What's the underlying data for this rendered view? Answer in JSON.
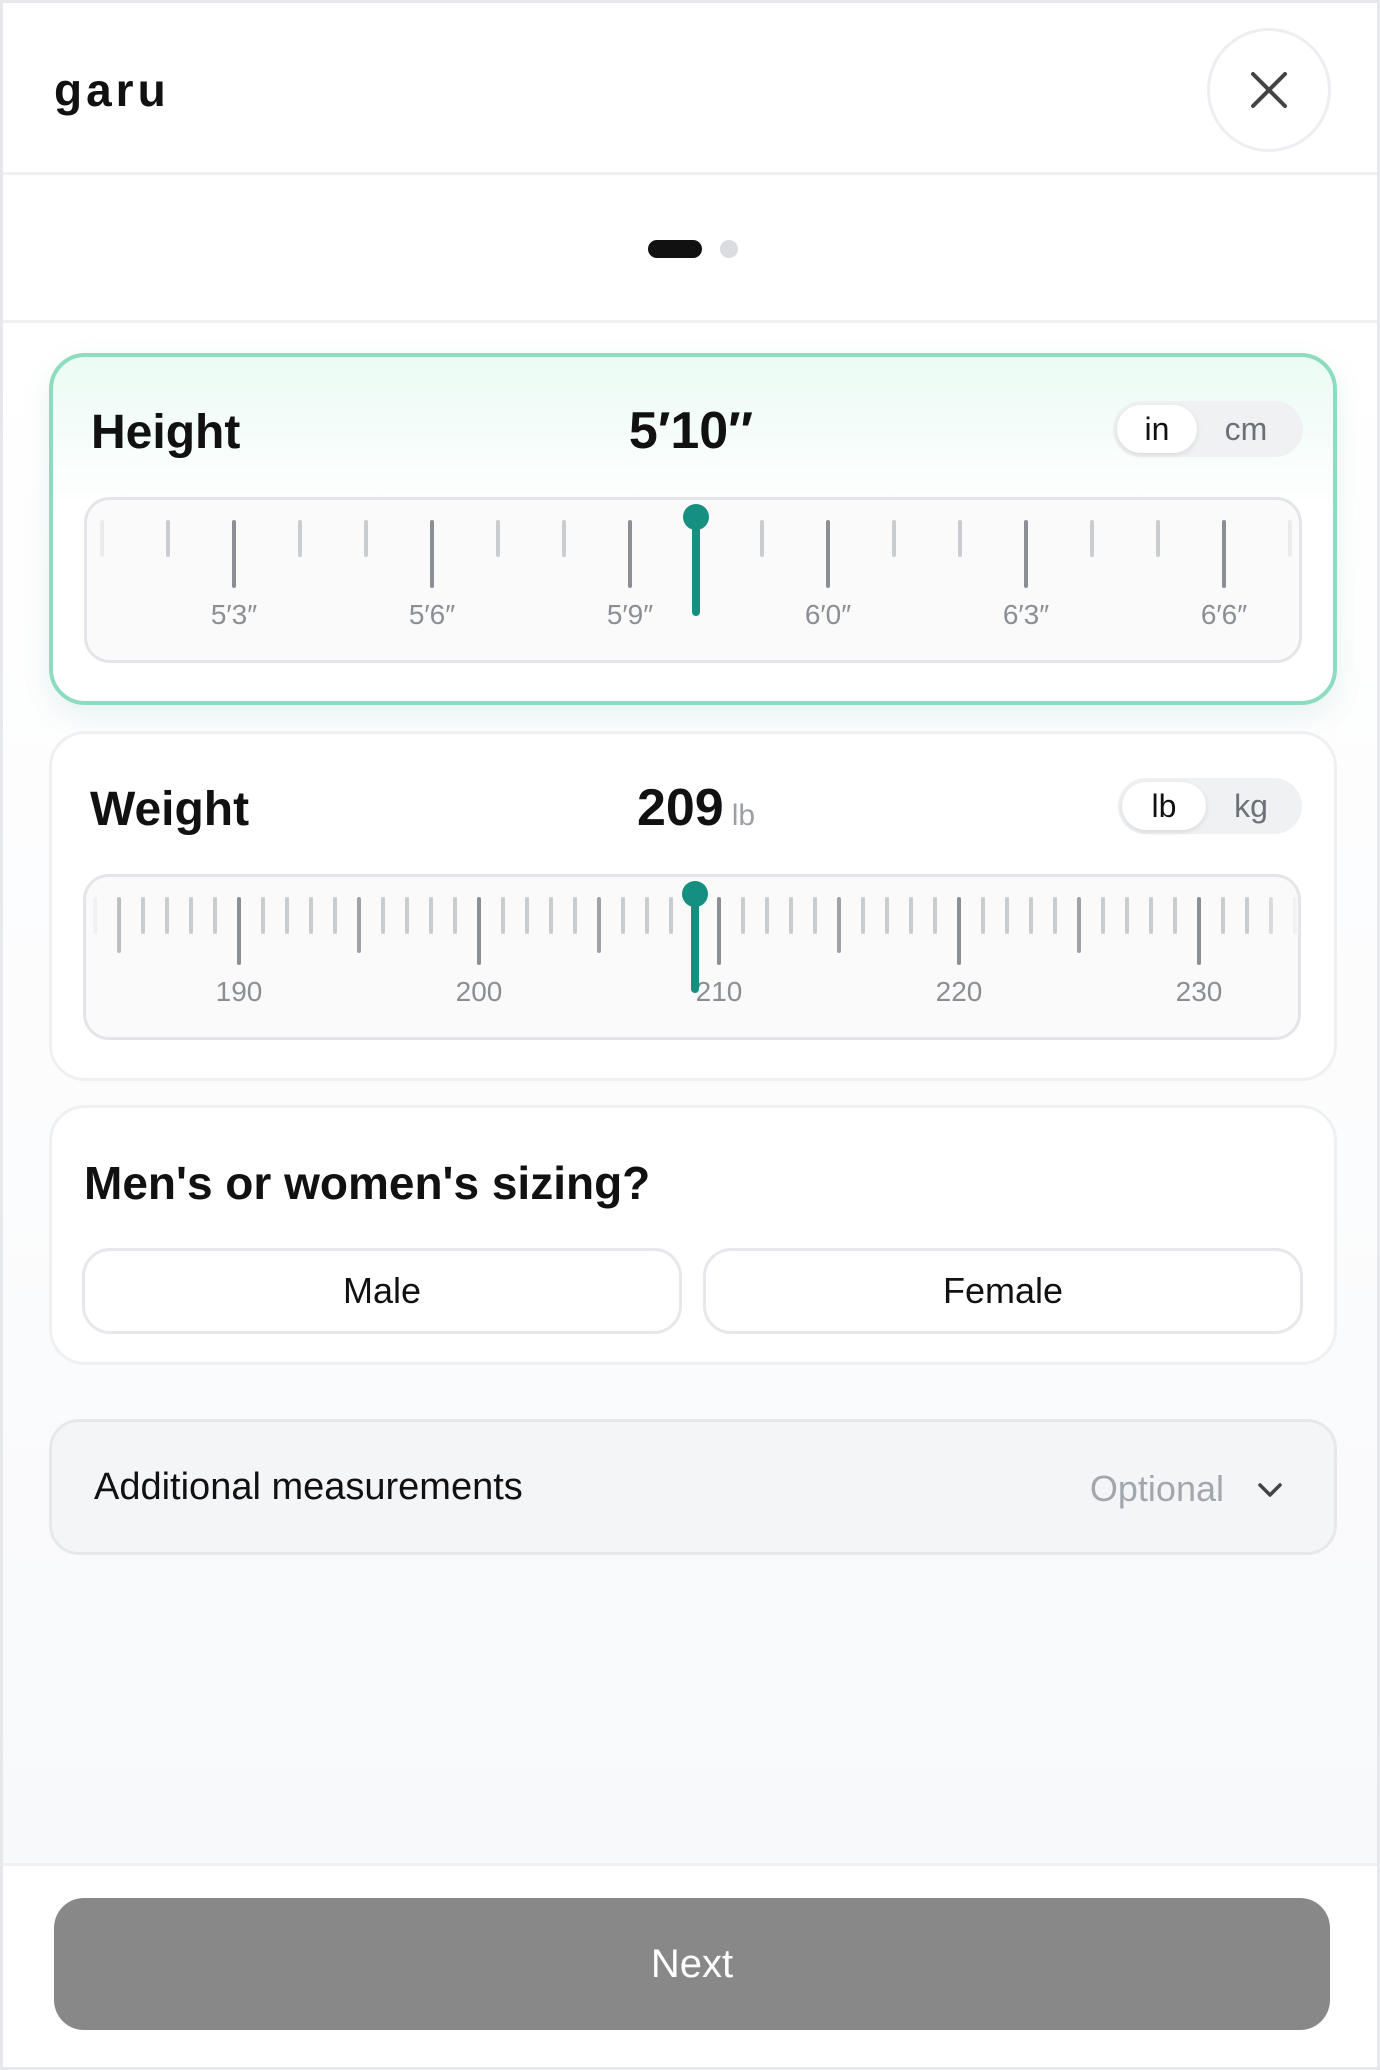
{
  "header": {
    "logo": "garu",
    "close_icon": "close-icon"
  },
  "progress": {
    "current_step": 1,
    "total_steps": 2
  },
  "height": {
    "title": "Height",
    "value": "5′10″",
    "units": [
      "in",
      "cm"
    ],
    "selected_unit": "in",
    "ruler": {
      "tick_labels": [
        "5′3″",
        "5′6″",
        "5′9″",
        "6′0″",
        "6′3″",
        "6′6″"
      ],
      "selected_inches": 70
    }
  },
  "weight": {
    "title": "Weight",
    "value": "209",
    "unit_label": "lb",
    "units": [
      "lb",
      "kg"
    ],
    "selected_unit": "lb",
    "ruler": {
      "tick_labels": [
        "190",
        "200",
        "210",
        "220",
        "230"
      ],
      "selected_value": 209
    }
  },
  "sizing": {
    "question": "Men's or women's sizing?",
    "options": [
      "Male",
      "Female"
    ]
  },
  "additional": {
    "label": "Additional measurements",
    "hint": "Optional",
    "chevron_icon": "chevron-down-icon"
  },
  "footer": {
    "next_label": "Next"
  },
  "colors": {
    "accent": "#148f80",
    "active_border": "#8edcc0",
    "button_disabled": "#888888"
  }
}
